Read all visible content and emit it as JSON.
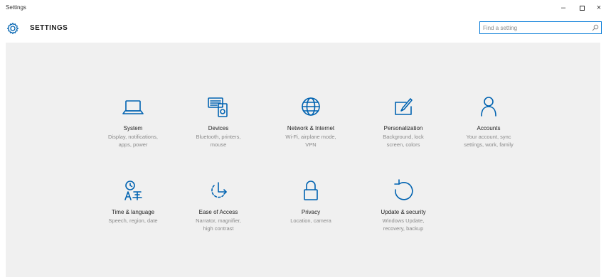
{
  "window": {
    "title": "Settings",
    "controls": {
      "minimize": "–",
      "maximize": "▫",
      "close": "×"
    }
  },
  "header": {
    "title": "SETTINGS",
    "icon": "gear-icon",
    "search_placeholder": "Find a setting",
    "search_value": ""
  },
  "colors": {
    "accent": "#0063b1",
    "background": "#f0f0f0",
    "muted_text": "#8a8a8a"
  },
  "tiles": [
    {
      "label": "System",
      "desc1": "Display, notifications,",
      "desc2": "apps, power",
      "desc3": "",
      "icon": "laptop-icon"
    },
    {
      "label": "Devices",
      "desc1": "Bluetooth, printers,",
      "desc2": "mouse",
      "desc3": "",
      "icon": "devices-icon"
    },
    {
      "label": "Network & Internet",
      "desc1": "Wi-Fi, airplane mode,",
      "desc2": "VPN",
      "desc3": "",
      "icon": "globe-icon"
    },
    {
      "label": "Personalization",
      "desc1": "Background, lock",
      "desc2": "screen, colors",
      "desc3": "",
      "icon": "paint-icon"
    },
    {
      "label": "Accounts",
      "desc1": "Your account, sync",
      "desc2": "settings, work, family",
      "desc3": "",
      "icon": "person-icon"
    },
    {
      "label": "Time & language",
      "desc1": "Speech, region, date",
      "desc2": "",
      "desc3": "",
      "icon": "time-language-icon"
    },
    {
      "label": "Ease of Access",
      "desc1": "Narrator, magnifier,",
      "desc2": "high contrast",
      "desc3": "",
      "icon": "ease-of-access-icon"
    },
    {
      "label": "Privacy",
      "desc1": "Location, camera",
      "desc2": "",
      "desc3": "",
      "icon": "lock-icon"
    },
    {
      "label": "Update & security",
      "desc1": "Windows Update,",
      "desc2": "recovery, backup",
      "desc3": "",
      "icon": "refresh-icon"
    }
  ]
}
